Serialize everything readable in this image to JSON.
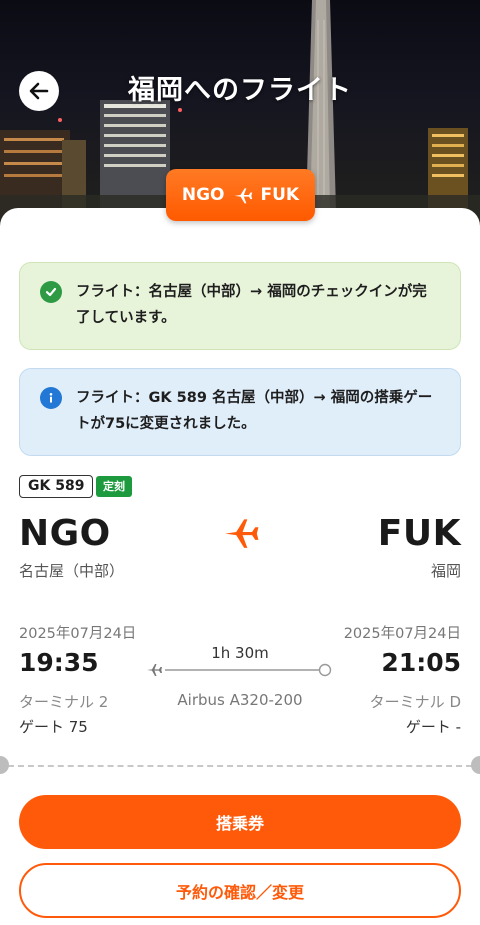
{
  "header": {
    "title": "福岡へのフライト",
    "back_label": "戻る"
  },
  "route_pill": {
    "origin": "NGO",
    "destination": "FUK"
  },
  "notices": [
    {
      "type": "success",
      "text": "フライト：名古屋（中部）→ 福岡のチェックインが完了しています。"
    },
    {
      "type": "info",
      "text": "フライト：GK 589 名古屋（中部）→ 福岡の搭乗ゲートが75に変更されました。"
    }
  ],
  "flight": {
    "number": "GK 589",
    "status": "定刻",
    "departure": {
      "code": "NGO",
      "city": "名古屋（中部）",
      "date": "2025年07月24日",
      "time": "19:35",
      "terminal": "ターミナル 2",
      "gate": "ゲート 75"
    },
    "arrival": {
      "code": "FUK",
      "city": "福岡",
      "date": "2025年07月24日",
      "time": "21:05",
      "terminal": "ターミナル D",
      "gate": "ゲート -"
    },
    "duration": "1h 30m",
    "aircraft": "Airbus A320-200"
  },
  "actions": {
    "boarding_pass": "搭乗券",
    "manage_booking": "予約の確認／変更"
  },
  "colors": {
    "accent": "#ff5a0a",
    "success": "#2e9a44",
    "info": "#2278d4"
  }
}
